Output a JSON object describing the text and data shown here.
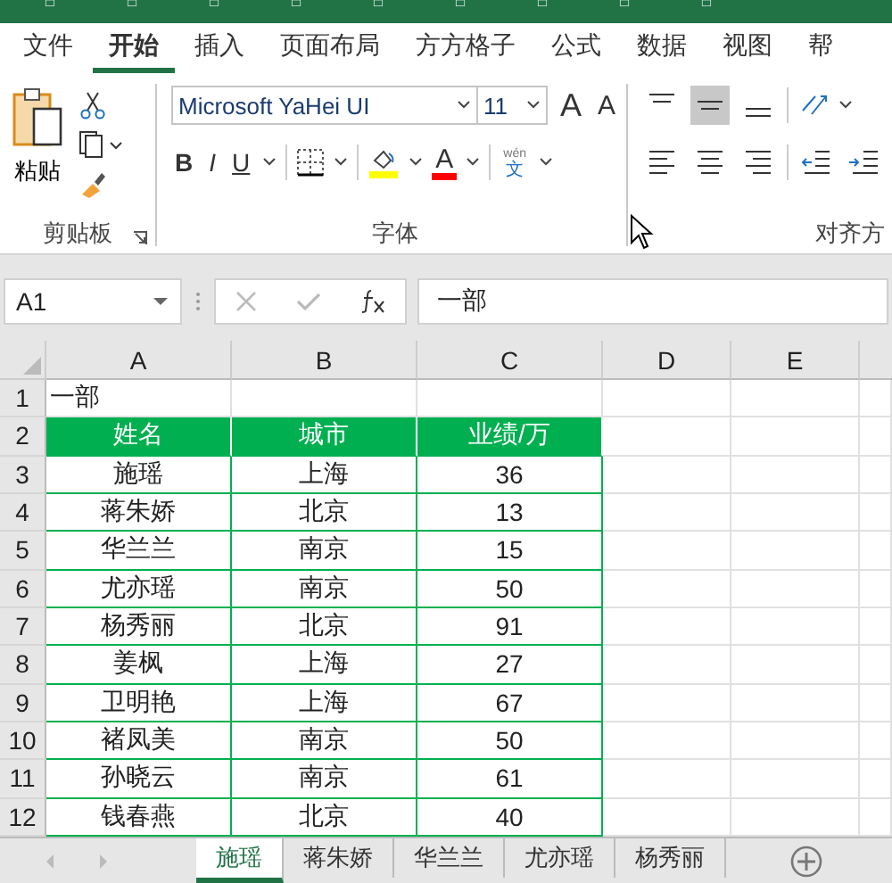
{
  "menu_tabs": [
    {
      "label": "文件",
      "selected": false
    },
    {
      "label": "开始",
      "selected": true
    },
    {
      "label": "插入",
      "selected": false
    },
    {
      "label": "页面布局",
      "selected": false
    },
    {
      "label": "方方格子",
      "selected": false
    },
    {
      "label": "公式",
      "selected": false
    },
    {
      "label": "数据",
      "selected": false
    },
    {
      "label": "视图",
      "selected": false
    },
    {
      "label": "帮",
      "selected": false
    }
  ],
  "clipboard": {
    "paste_label": "粘贴",
    "group_label": "剪贴板"
  },
  "font": {
    "name": "Microsoft YaHei UI",
    "size": "11",
    "grow_label": "A",
    "shrink_label": "A",
    "bold": "B",
    "italic": "I",
    "underline": "U",
    "font_color_label": "A",
    "phonetic_top": "wén",
    "phonetic_bottom": "文",
    "group_label": "字体"
  },
  "alignment": {
    "group_label": "对齐方",
    "middle_align_selected": true
  },
  "name_box": "A1",
  "formula": "一部",
  "columns": [
    "A",
    "B",
    "C",
    "D",
    "E"
  ],
  "rows": [
    {
      "number": "1",
      "kind": "title",
      "cells": [
        "一部",
        "",
        ""
      ]
    },
    {
      "number": "2",
      "kind": "header",
      "cells": [
        "姓名",
        "城市",
        "业绩/万"
      ]
    },
    {
      "number": "3",
      "kind": "data",
      "cells": [
        "施瑶",
        "上海",
        "36"
      ]
    },
    {
      "number": "4",
      "kind": "data",
      "cells": [
        "蒋朱娇",
        "北京",
        "13"
      ]
    },
    {
      "number": "5",
      "kind": "data",
      "cells": [
        "华兰兰",
        "南京",
        "15"
      ]
    },
    {
      "number": "6",
      "kind": "data",
      "cells": [
        "尤亦瑶",
        "南京",
        "50"
      ]
    },
    {
      "number": "7",
      "kind": "data",
      "cells": [
        "杨秀丽",
        "北京",
        "91"
      ]
    },
    {
      "number": "8",
      "kind": "data",
      "cells": [
        "姜枫",
        "上海",
        "27"
      ]
    },
    {
      "number": "9",
      "kind": "data",
      "cells": [
        "卫明艳",
        "上海",
        "67"
      ]
    },
    {
      "number": "10",
      "kind": "data",
      "cells": [
        "褚凤美",
        "南京",
        "50"
      ]
    },
    {
      "number": "11",
      "kind": "data",
      "cells": [
        "孙晓云",
        "南京",
        "61"
      ]
    },
    {
      "number": "12",
      "kind": "data",
      "cells": [
        "钱春燕",
        "北京",
        "40"
      ]
    }
  ],
  "sheet_tabs": [
    {
      "label": "施瑶",
      "selected": true
    },
    {
      "label": "蒋朱娇",
      "selected": false
    },
    {
      "label": "华兰兰",
      "selected": false
    },
    {
      "label": "尤亦瑶",
      "selected": false
    },
    {
      "label": "杨秀丽",
      "selected": false
    }
  ]
}
